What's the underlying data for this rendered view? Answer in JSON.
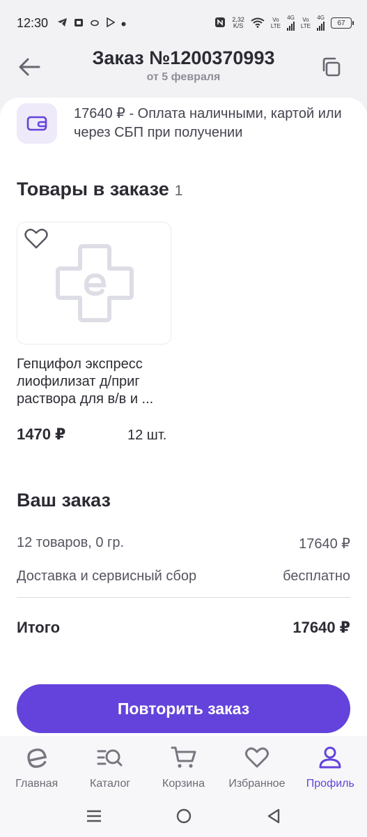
{
  "status_bar": {
    "time": "12:30",
    "net_speed_value": "2,32",
    "net_speed_unit": "K/S",
    "sim1_tag_top": "Vo",
    "sim1_tag_bottom": "LTE",
    "sim1_gen": "4G",
    "sim2_tag_top": "Vo",
    "sim2_tag_bottom": "LTE",
    "sim2_gen": "4G",
    "battery": "67"
  },
  "header": {
    "title": "Заказ №1200370993",
    "subtitle": "от 5 февраля"
  },
  "payment": {
    "text": "17640 ₽ - Оплата наличными, картой или через СБП при получении"
  },
  "items_section": {
    "title": "Товары в заказе",
    "count": "1"
  },
  "product": {
    "name": "Гепцифол экспресс лиофилизат д/приг раствора для в/в и ...",
    "price": "1470 ₽",
    "quantity": "12 шт."
  },
  "summary": {
    "title": "Ваш заказ",
    "goods_label": "12 товаров, 0 гр.",
    "goods_value": "17640 ₽",
    "delivery_label": "Доставка и сервисный сбор",
    "delivery_value": "бесплатно",
    "total_label": "Итого",
    "total_value": "17640 ₽"
  },
  "actions": {
    "repeat_label": "Повторить заказ"
  },
  "bottom_nav": {
    "items": [
      {
        "label": "Главная",
        "icon": "home-e-icon"
      },
      {
        "label": "Каталог",
        "icon": "catalog-search-icon"
      },
      {
        "label": "Корзина",
        "icon": "cart-icon"
      },
      {
        "label": "Избранное",
        "icon": "heart-icon"
      },
      {
        "label": "Профиль",
        "icon": "profile-icon"
      }
    ],
    "active_index": 4
  },
  "colors": {
    "accent": "#6343db",
    "text_primary": "#2b2b33",
    "text_secondary": "#8e8e98",
    "background": "#f2f2f5"
  }
}
